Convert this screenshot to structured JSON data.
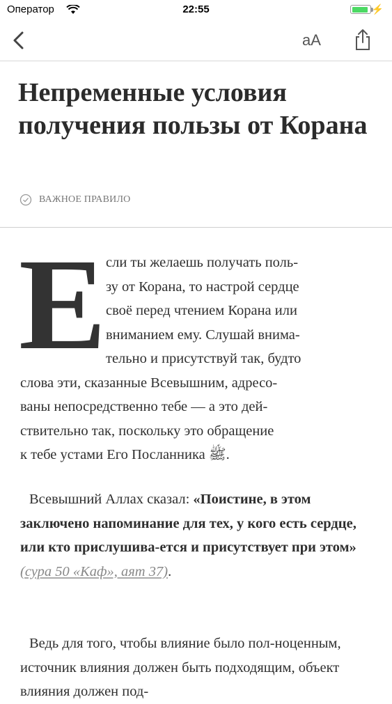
{
  "status_bar": {
    "carrier": "Оператор",
    "time": "22:55",
    "battery_fill": 0.95
  },
  "navbar": {
    "back_icon": "chevron-left-icon",
    "font_size_label": "aA",
    "share_icon": "share-icon"
  },
  "article": {
    "title": "Непременные условия получения пользы от Корана",
    "tag": "ВАЖНОЕ ПРАВИЛО",
    "drop_cap": "Е",
    "p1_lines": [
      "сли ты желаешь получать поль-",
      "зу от Корана, то настрой сердце",
      "своё перед чтением Корана или",
      "вниманием ему. Слушай внима-",
      "тельно и присутствуй так, будто",
      "слова эти, сказанные Всевышним, адресо-",
      "ваны непосредственно тебе — а это дей-",
      "ствительно так, поскольку это обращение",
      "к тебе устами Его Посланника ﷺ."
    ],
    "p2_intro": "Всевышний Аллах сказал: ",
    "p2_quote": "«Поистине, в этом заключено напоминание для тех, у кого есть сердце, или кто прислушива-ется и присутствует при этом»",
    "p2_ref": "(сура 50 «Каф», аят 37)",
    "p2_end": ".",
    "p3": "Ведь для того, чтобы влияние было пол-ноценным, источник влияния должен быть подходящим, объект влияния должен под-"
  }
}
